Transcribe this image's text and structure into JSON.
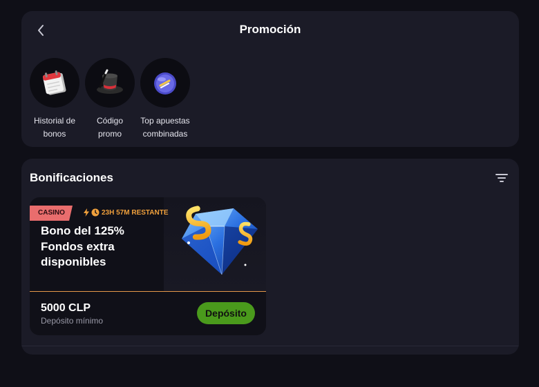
{
  "header": {
    "title": "Promoción",
    "back_icon": "chevron-left-icon"
  },
  "shortcuts": [
    {
      "label": "Historial de bonos",
      "line1": "Historial de",
      "line2": "bonos",
      "icon": "calendar-icon"
    },
    {
      "label": "Código promo",
      "line1": "Código",
      "line2": "promo",
      "icon": "magic-hat-icon"
    },
    {
      "label": "Top apuestas combinadas",
      "line1": "Top apuestas",
      "line2": "combinadas",
      "icon": "trophy-ball-icon"
    }
  ],
  "bonuses": {
    "title": "Bonificaciones",
    "filter_icon": "filter-icon",
    "cards": [
      {
        "badge": "CASINO",
        "timer": "23H 57M RESTANTE",
        "title_lines": [
          "Bono del 125%",
          "Fondos extra",
          "disponibles"
        ],
        "amount": "5000 CLP",
        "amount_label": "Depósito mínimo",
        "button_label": "Depósito",
        "image": "diamond-coins-icon"
      }
    ]
  },
  "colors": {
    "background": "#0f0f17",
    "panel": "#1b1b27",
    "badge": "#e96d6d",
    "timer": "#f0a03c",
    "button": "#4a9a1c",
    "divider": "#e79a4a"
  }
}
